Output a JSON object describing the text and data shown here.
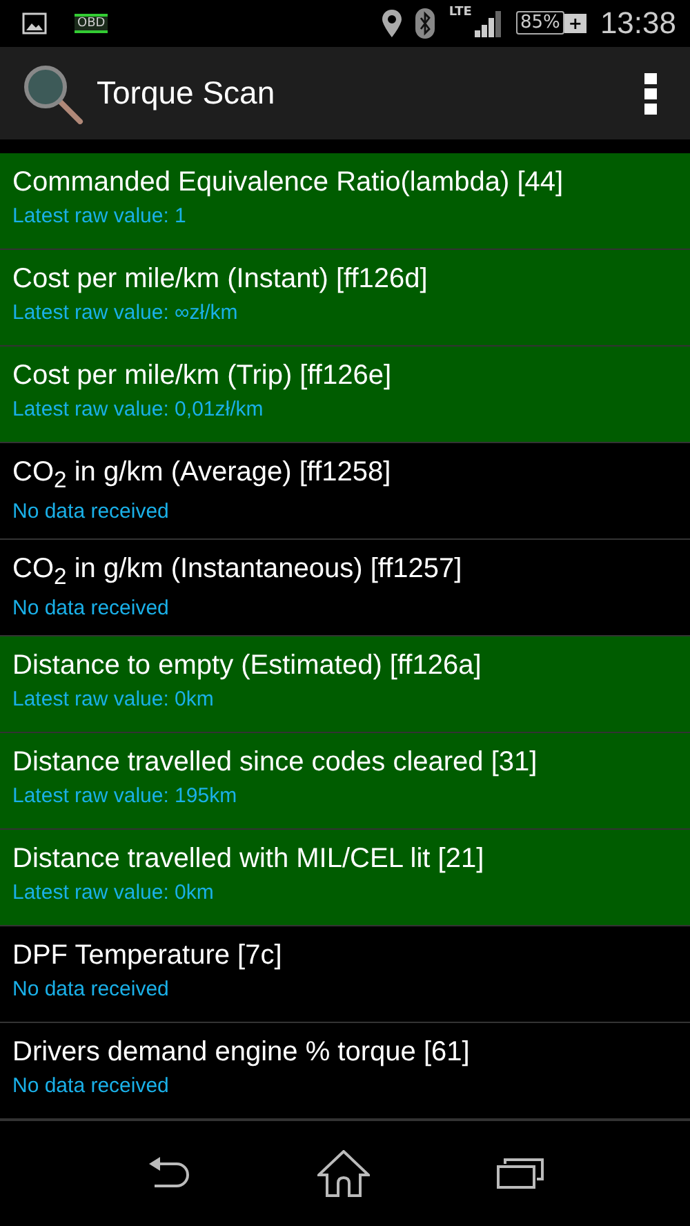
{
  "status_bar": {
    "obd_label": "OBD",
    "network": "LTE",
    "battery": "85%",
    "battery_plus": "+",
    "time": "13:38"
  },
  "action_bar": {
    "title": "Torque Scan"
  },
  "items": [
    {
      "name": "Commanded Equivalence Ratio(lambda) [44]",
      "detail": "Latest raw value: 1",
      "selected": true
    },
    {
      "name": "Cost per mile/km (Instant) [ff126d]",
      "detail": "Latest raw value: ∞zł/km",
      "selected": true
    },
    {
      "name": "Cost per mile/km (Trip) [ff126e]",
      "detail": "Latest raw value: 0,01zł/km",
      "selected": true
    },
    {
      "name": "CO$_{2}$ in g/km (Average) [ff1258]",
      "detail": "No data received",
      "selected": false
    },
    {
      "name": "CO$_{2}$ in g/km (Instantaneous) [ff1257]",
      "detail": "No data received",
      "selected": false
    },
    {
      "name": "Distance to empty (Estimated) [ff126a]",
      "detail": "Latest raw value: 0km",
      "selected": true
    },
    {
      "name": "Distance travelled since codes cleared [31]",
      "detail": "Latest raw value: 195km",
      "selected": true
    },
    {
      "name": "Distance travelled with MIL/CEL lit [21]",
      "detail": "Latest raw value: 0km",
      "selected": true
    },
    {
      "name": "DPF Temperature [7c]",
      "detail": "No data received",
      "selected": false
    },
    {
      "name": "Drivers demand engine % torque [61]",
      "detail": "No data received",
      "selected": false
    }
  ]
}
